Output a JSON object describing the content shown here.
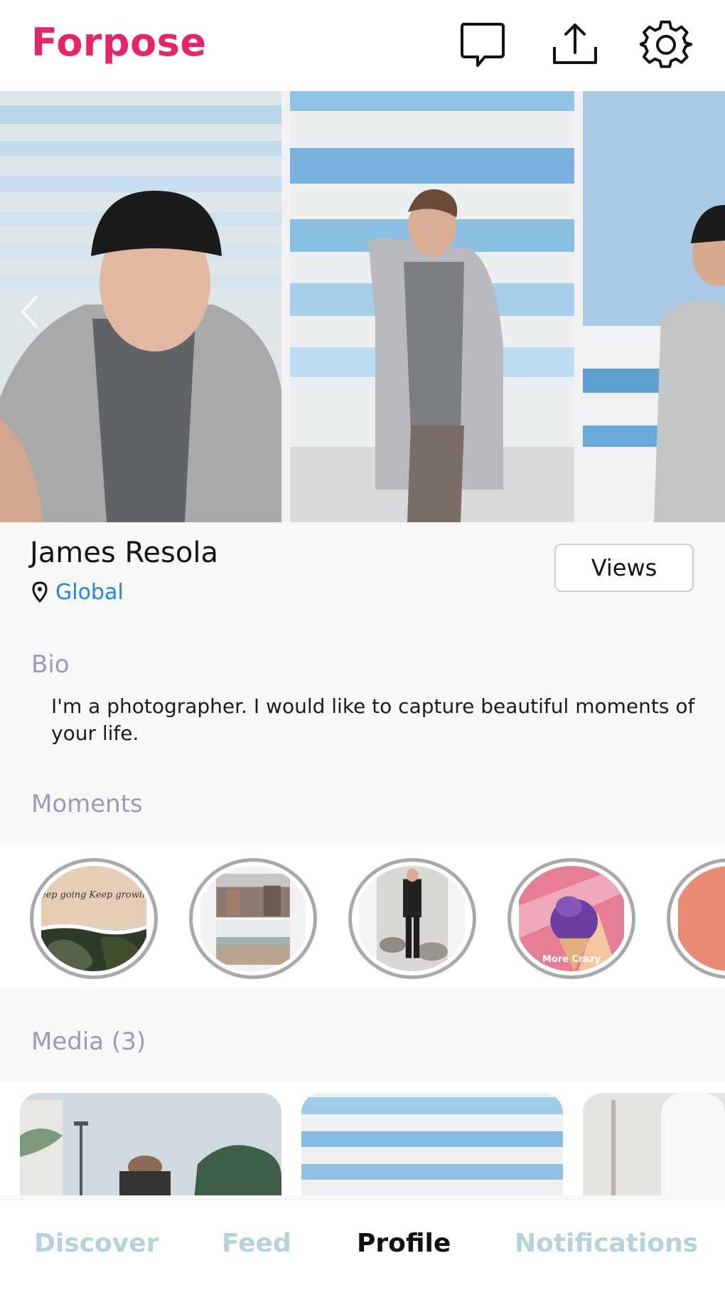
{
  "app": {
    "title": "Forpose"
  },
  "header": {
    "icons": [
      "chat-bubble-icon",
      "share-upload-icon",
      "gear-icon"
    ]
  },
  "profile": {
    "name": "James Resola",
    "location": "Global",
    "views_label": "Views"
  },
  "bio": {
    "title": "Bio",
    "text": "I'm a photographer. I would like to capture beautiful moments of your life."
  },
  "moments": {
    "title": "Moments",
    "items": [
      {
        "caption": "Keep going Keep growing"
      },
      {
        "caption": ""
      },
      {
        "caption": ""
      },
      {
        "caption": "More Crazy"
      },
      {
        "caption": ""
      }
    ]
  },
  "media": {
    "title": "Media (3)"
  },
  "nav": {
    "items": [
      {
        "label": "Discover",
        "active": false
      },
      {
        "label": "Feed",
        "active": false
      },
      {
        "label": "Profile",
        "active": true
      },
      {
        "label": "Notifications",
        "active": false
      }
    ]
  },
  "colors": {
    "brand": "#ea2368",
    "link": "#1a86e8",
    "section_title": "#9c9ab6",
    "nav_inactive": "#b5d3da"
  }
}
